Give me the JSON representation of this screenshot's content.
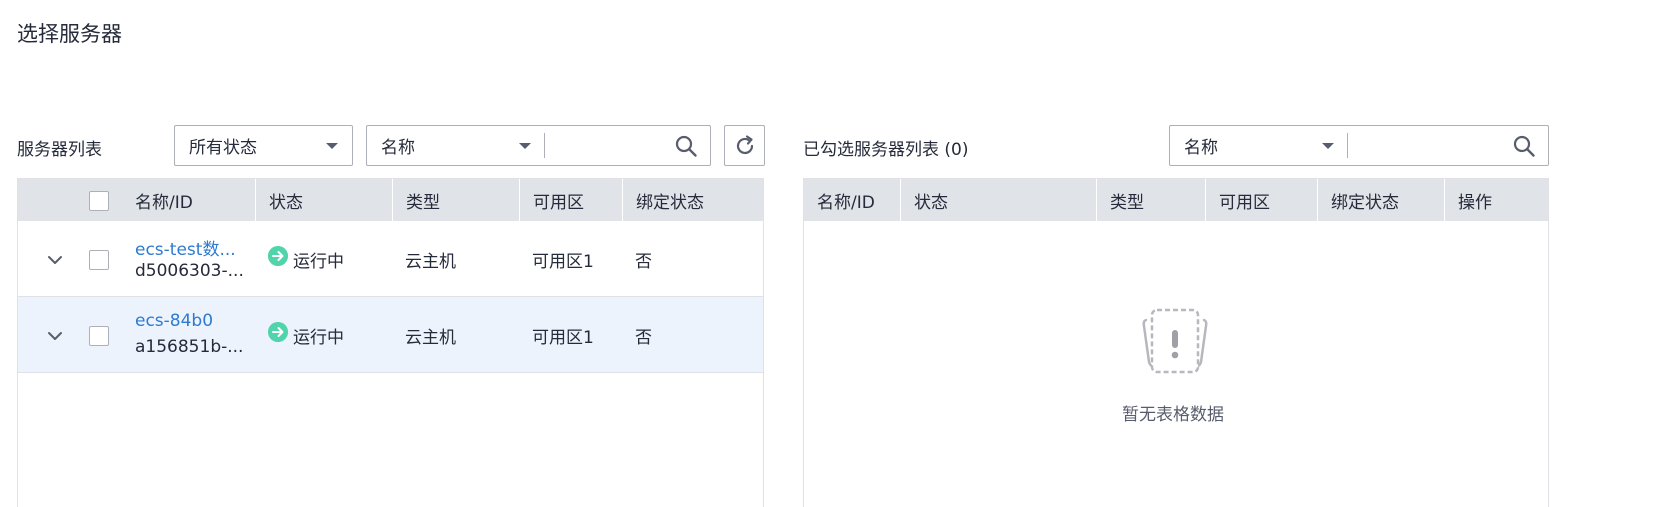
{
  "page_title": "选择服务器",
  "left_panel": {
    "label": "服务器列表",
    "status_filter": "所有状态",
    "search_field": "名称",
    "search_value": "",
    "columns": [
      "名称/ID",
      "状态",
      "类型",
      "可用区",
      "绑定状态"
    ],
    "rows": [
      {
        "name": "ecs-test数...",
        "id": "d5006303-...",
        "status": "运行中",
        "type": "云主机",
        "zone": "可用区1",
        "bound": "否"
      },
      {
        "name": "ecs-84b0",
        "id": "a156851b-...",
        "status": "运行中",
        "type": "云主机",
        "zone": "可用区1",
        "bound": "否"
      }
    ]
  },
  "right_panel": {
    "label": "已勾选服务器列表 (0)",
    "search_field": "名称",
    "search_value": "",
    "columns": [
      "名称/ID",
      "状态",
      "类型",
      "可用区",
      "绑定状态",
      "操作"
    ],
    "empty_text": "暂无表格数据"
  },
  "colors": {
    "accent_link": "#2e7ad0",
    "status_running": "#50d4ab",
    "header_bg": "#e0e3e8",
    "selected_row_bg": "#edf3fc"
  },
  "icons": [
    "chevron-down-icon",
    "search-icon",
    "refresh-icon",
    "arrow-right-circle-icon",
    "empty-table-icon"
  ]
}
